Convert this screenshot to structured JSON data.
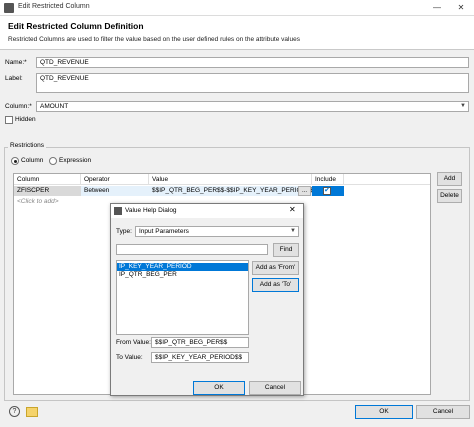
{
  "window": {
    "title": "Edit Restricted Column",
    "minimize": "—",
    "close": "✕"
  },
  "header": {
    "title": "Edit Restricted Column Definition",
    "description": "Restricted Columns are used to filter the value based on the user defined rules on the attribute values"
  },
  "form": {
    "name_label": "Name:*",
    "name_value": "QTD_REVENUE",
    "label_label": "Label:",
    "label_value": "QTD_REVENUE",
    "column_label": "Column:*",
    "column_value": "AMOUNT",
    "hidden_label": "Hidden",
    "hidden_checked": false
  },
  "restrictions": {
    "group_label": "Restrictions",
    "mode_column": "Column",
    "mode_expression": "Expression",
    "mode_selected": "Column",
    "headers": [
      "Column",
      "Operator",
      "Value",
      "Include"
    ],
    "rows": [
      {
        "column": "ZFISCPER",
        "operator": "Between",
        "value": "$$IP_QTR_BEG_PER$$-$$IP_KEY_YEAR_PERIOD$$",
        "value_button": "...",
        "include": true
      }
    ],
    "add_row_hint": "<Click to add>",
    "add_button": "Add",
    "delete_button": "Delete"
  },
  "dialog": {
    "title": "Value Help Dialog",
    "close": "✕",
    "type_label": "Type:",
    "type_value": "Input Parameters",
    "search_value": "",
    "find_button": "Find",
    "items": [
      "IP_KEY_YEAR_PERIOD",
      "IP_QTR_BEG_PER"
    ],
    "selected_index": 0,
    "add_from_button": "Add as 'From'",
    "add_to_button": "Add as 'To'",
    "from_label": "From Value:",
    "from_value": "$$IP_QTR_BEG_PER$$",
    "to_label": "To Value:",
    "to_value": "$$IP_KEY_YEAR_PERIOD$$",
    "ok_button": "OK",
    "cancel_button": "Cancel"
  },
  "footer": {
    "help_icon": "?",
    "ok_button": "OK",
    "cancel_button": "Cancel"
  },
  "colors": {
    "selection": "#0078d7",
    "background": "#f0f0f0"
  }
}
